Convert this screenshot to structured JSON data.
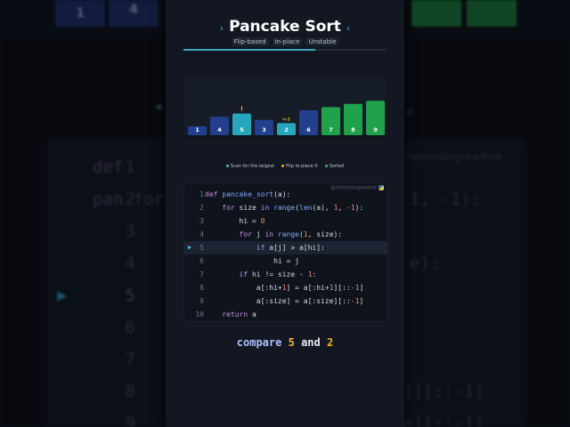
{
  "header": {
    "title": "Pancake Sort",
    "tags": [
      "Flip-based",
      "In-place",
      "Unstable"
    ],
    "progress": 0.65
  },
  "chart_data": {
    "type": "bar",
    "values": [
      1,
      4,
      5,
      3,
      2,
      6,
      7,
      8,
      9
    ],
    "labels": [
      "1",
      "4",
      "5",
      "3",
      "2",
      "6",
      "7",
      "8",
      "9"
    ],
    "states": [
      "default",
      "default",
      "compare",
      "default",
      "compare",
      "default",
      "sorted",
      "sorted",
      "sorted"
    ],
    "markers": {
      "2": "!",
      "4": "i+2"
    },
    "colors": {
      "default": "#23408e",
      "compare": "#27a7bc",
      "sorted": "#20a14a"
    }
  },
  "legend": [
    {
      "label": "Scan for the largest",
      "color": "#3fc1d6"
    },
    {
      "label": "Flip to place it",
      "color": "#f0b429"
    },
    {
      "label": "Sorted",
      "color": "#2fbf5a"
    }
  ],
  "code": {
    "watermark": "@themissingreadme",
    "active_line": 5,
    "lines": [
      {
        "n": "1",
        "t": "def pancake_sort(a):"
      },
      {
        "n": "2",
        "t": "    for size in range(len(a), 1, -1):"
      },
      {
        "n": "3",
        "t": "        hi = 0"
      },
      {
        "n": "4",
        "t": "        for j in range(1, size):"
      },
      {
        "n": "5",
        "t": "            if a[j] > a[hi]:"
      },
      {
        "n": "6",
        "t": "                hi = j"
      },
      {
        "n": "7",
        "t": "        if hi != size - 1:"
      },
      {
        "n": "8",
        "t": "            a[:hi+1] = a[:hi+1][::-1]"
      },
      {
        "n": "9",
        "t": "            a[:size] = a[:size][::-1]"
      },
      {
        "n": "10",
        "t": "    return a"
      }
    ]
  },
  "status": {
    "prefix": "compare",
    "a": "5",
    "mid": "and",
    "b": "2"
  },
  "background": {
    "bar_labels": [
      "1",
      "4"
    ],
    "code_lines": [
      {
        "n": "1",
        "t": "def pan"
      },
      {
        "n": "2",
        "t": "    for"
      },
      {
        "n": "3",
        "t": ""
      },
      {
        "n": "4",
        "t": ""
      },
      {
        "n": "5",
        "t": ""
      },
      {
        "n": "6",
        "t": ""
      },
      {
        "n": "7",
        "t": ""
      },
      {
        "n": "8",
        "t": ""
      },
      {
        "n": "9",
        "t": ""
      }
    ],
    "right_fragments": [
      "1, -1):",
      "e):",
      "]][::-1]",
      "e][::-1]"
    ],
    "fragment_d": "d",
    "watermark": "themissingreadme"
  }
}
